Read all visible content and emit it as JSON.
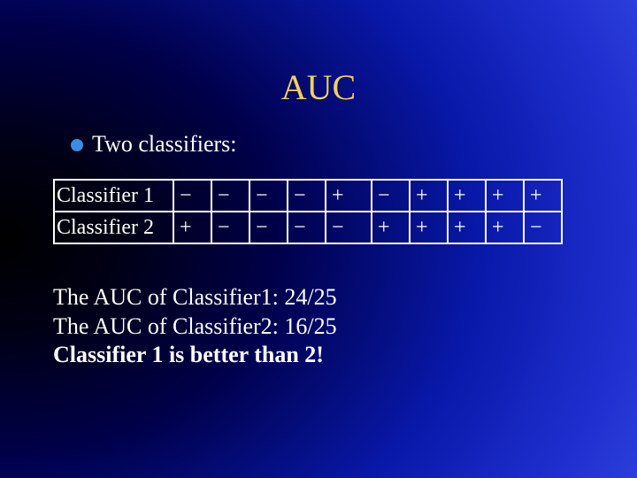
{
  "title": "AUC",
  "subtitle": "Two classifiers:",
  "table": {
    "rows": [
      {
        "label": "Classifier 1",
        "cells": [
          "−",
          "−",
          "−",
          "−",
          "+",
          "−",
          "+",
          "+",
          "+",
          "+"
        ]
      },
      {
        "label": "Classifier 2",
        "cells": [
          "+",
          "−",
          "−",
          "−",
          "−",
          "+",
          "+",
          "+",
          "+",
          "−"
        ]
      }
    ]
  },
  "conclusion": {
    "line1": "The AUC of Classifier1: 24/25",
    "line2": "The AUC of Classifier2: 16/25",
    "line3": "Classifier 1 is better than 2!"
  }
}
